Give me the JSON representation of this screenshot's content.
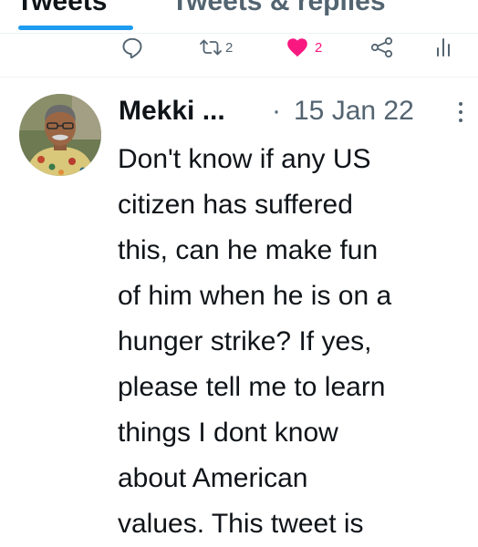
{
  "tabs": {
    "tweets_label": "Tweets",
    "replies_label": "Tweets & replies"
  },
  "actions": {
    "reply_icon": "reply-icon",
    "retweet_icon": "retweet-icon",
    "retweet_count": "2",
    "like_icon": "heart-icon",
    "like_count": "2",
    "share_icon": "share-icon",
    "analytics_icon": "analytics-icon"
  },
  "colors": {
    "accent": "#1d9bf0",
    "like": "#f91880",
    "muted": "#536471",
    "text": "#0f1419"
  },
  "tweet": {
    "author_name": "Mekki ...",
    "separator": "·",
    "date": "15 Jan 22",
    "text": "Don't know if any US\ncitizen has suffered\nthis, can he make fun\nof him when he is on a\nhunger strike? If yes,\nplease tell me to learn\nthings I dont know\nabout American\nvalues. This tweet is"
  }
}
